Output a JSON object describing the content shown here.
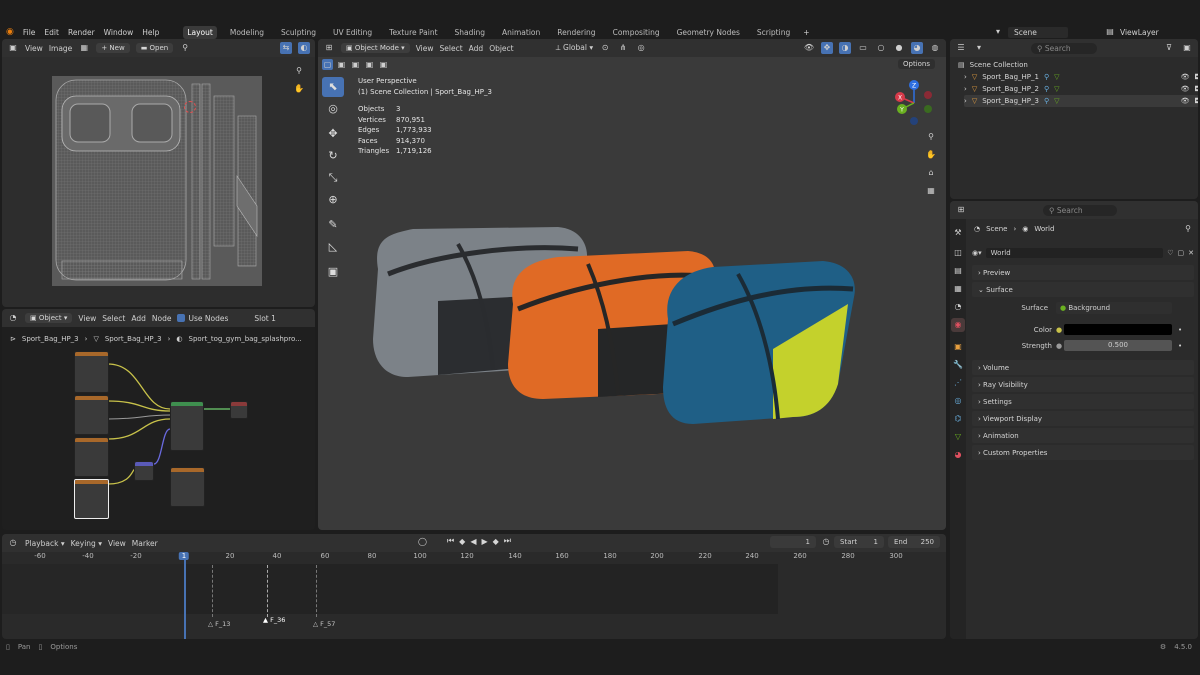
{
  "menubar": {
    "file": "File",
    "edit": "Edit",
    "render": "Render",
    "window": "Window",
    "help": "Help",
    "scene": "Scene",
    "view_layer": "ViewLayer"
  },
  "workspaces": [
    "Layout",
    "Modeling",
    "Sculpting",
    "UV Editing",
    "Texture Paint",
    "Shading",
    "Animation",
    "Rendering",
    "Compositing",
    "Geometry Nodes",
    "Scripting"
  ],
  "image_editor": {
    "view": "View",
    "image": "Image",
    "new": "New",
    "open": "Open"
  },
  "node_editor": {
    "mode": "Object",
    "view": "View",
    "select": "Select",
    "add": "Add",
    "node": "Node",
    "use_nodes": "Use Nodes",
    "slot": "Slot 1",
    "crumb1": "Sport_Bag_HP_3",
    "crumb2": "Sport_Bag_HP_3",
    "crumb3": "Sport_tog_gym_bag_splashpro..."
  },
  "viewport": {
    "mode": "Object Mode",
    "view": "View",
    "select": "Select",
    "add": "Add",
    "object": "Object",
    "transform": "Global",
    "options": "Options",
    "perspective": "User Perspective",
    "collection": "(1) Scene Collection | Sport_Bag_HP_3",
    "stats": [
      {
        "label": "Objects",
        "value": "3"
      },
      {
        "label": "Vertices",
        "value": "870,951"
      },
      {
        "label": "Edges",
        "value": "1,773,933"
      },
      {
        "label": "Faces",
        "value": "914,370"
      },
      {
        "label": "Triangles",
        "value": "1,719,126"
      }
    ],
    "gizmo": {
      "x": "X",
      "y": "Y",
      "z": "Z"
    }
  },
  "outliner": {
    "search": "Search",
    "collection": "Scene Collection",
    "items": [
      "Sport_Bag_HP_1",
      "Sport_Bag_HP_2",
      "Sport_Bag_HP_3"
    ]
  },
  "properties": {
    "search": "Search",
    "crumb_scene": "Scene",
    "crumb_world": "World",
    "world_name": "World",
    "preview": "Preview",
    "surface": "Surface",
    "surface_label": "Surface",
    "surface_value": "Background",
    "color_label": "Color",
    "color_value": "#000000",
    "strength_label": "Strength",
    "strength_value": "0.500",
    "sections": [
      "Volume",
      "Ray Visibility",
      "Settings",
      "Viewport Display",
      "Animation",
      "Custom Properties"
    ]
  },
  "timeline": {
    "playback": "Playback",
    "keying": "Keying",
    "view": "View",
    "marker": "Marker",
    "current": "1",
    "start_label": "Start",
    "start": "1",
    "end_label": "End",
    "end": "250",
    "ticks": [
      "-60",
      "-40",
      "-20",
      "1",
      "20",
      "40",
      "60",
      "80",
      "100",
      "120",
      "140",
      "160",
      "180",
      "200",
      "220",
      "240",
      "260",
      "280",
      "300"
    ],
    "markers": [
      "F_13",
      "F_36",
      "F_57"
    ]
  },
  "statusbar": {
    "pan": "Pan",
    "options": "Options",
    "version": "4.5.0"
  },
  "colors": {
    "accent": "#4772b3",
    "bag_gray": "#7c8288",
    "bag_orange": "#e06a25",
    "bag_blue": "#1f5f86",
    "bag_yellow": "#c4d12c"
  }
}
